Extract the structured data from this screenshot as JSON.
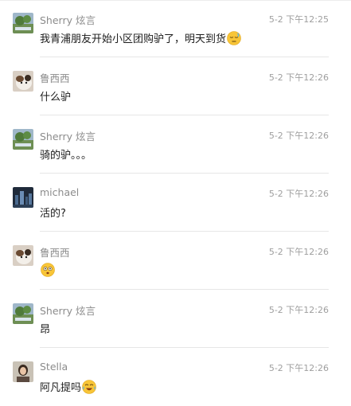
{
  "messages": [
    {
      "name": "Sherry 炫言",
      "time": "5-2 下午12:25",
      "text": "我青浦朋友开始小区团购驴了，明天到货",
      "emoji": "sleepy-face-icon",
      "avatar": "avatar-sherry"
    },
    {
      "name": "鲁西西",
      "time": "5-2 下午12:26",
      "text": "什么驴",
      "emoji": null,
      "avatar": "avatar-luxixi"
    },
    {
      "name": "Sherry 炫言",
      "time": "5-2 下午12:26",
      "text": "骑的驴。。。",
      "emoji": null,
      "avatar": "avatar-sherry"
    },
    {
      "name": "michael",
      "time": "5-2 下午12:26",
      "text": "活的?",
      "emoji": null,
      "avatar": "avatar-michael"
    },
    {
      "name": "鲁西西",
      "time": "5-2 下午12:26",
      "text": "",
      "emoji": "astonished-face-icon",
      "avatar": "avatar-luxixi"
    },
    {
      "name": "Sherry 炫言",
      "time": "5-2 下午12:26",
      "text": "昂",
      "emoji": null,
      "avatar": "avatar-sherry"
    },
    {
      "name": "Stella",
      "time": "5-2 下午12:26",
      "text": "阿凡提吗",
      "emoji": "tears-of-joy-face-icon",
      "avatar": "avatar-stella"
    }
  ]
}
